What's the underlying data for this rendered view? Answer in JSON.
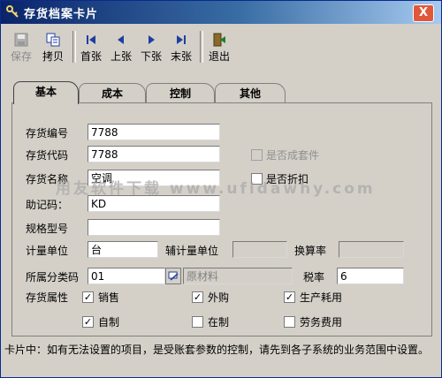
{
  "window": {
    "title": "存货档案卡片",
    "close": "X"
  },
  "toolbar": {
    "save": "保存",
    "copy": "拷贝",
    "first": "首张",
    "prev": "上张",
    "next": "下张",
    "last": "末张",
    "exit": "退出"
  },
  "tabs": [
    "基本",
    "成本",
    "控制",
    "其他"
  ],
  "form": {
    "code_label": "存货编号",
    "code": "7788",
    "daima_label": "存货代码",
    "daima": "7788",
    "name_label": "存货名称",
    "name": "空调",
    "mnemonic_label": "助记码：",
    "mnemonic": "KD",
    "spec_label": "规格型号",
    "spec": "",
    "unit_label": "计量单位",
    "unit": "台",
    "aux_unit_label": "辅计量单位",
    "aux_unit": "",
    "rate_label": "换算率",
    "rate": "",
    "class_label": "所属分类码",
    "class_code": "01",
    "class_name": "原材料",
    "tax_label": "税率",
    "tax": "6",
    "attr_label": "存货属性",
    "composite_label": "是否成套件",
    "discount_label": "是否折扣",
    "attrs": {
      "sale": "销售",
      "purchase": "外购",
      "production": "生产耗用",
      "selfmade": "自制",
      "wip": "在制",
      "labor": "劳务费用"
    },
    "checks": {
      "composite": false,
      "discount": false,
      "sale": true,
      "purchase": true,
      "production": true,
      "selfmade": true,
      "wip": false,
      "labor": false
    }
  },
  "watermark": "用友软件下载 www.ufidawhy.com",
  "footer": "卡片中：如有无法设置的项目，是受账套参数的控制，请先到各子系统的业务范围中设置。",
  "colors": {
    "title_start": "#0a246a",
    "title_end": "#a6caf0",
    "close": "#e0583a",
    "icon_blue": "#1f3f9f"
  }
}
